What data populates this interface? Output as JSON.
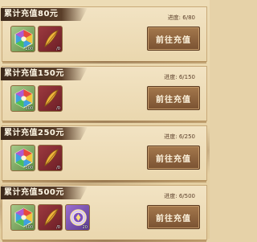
{
  "cards": [
    {
      "title": "累计充值80元",
      "progress": "进度: 6/80",
      "button": "前往充值",
      "rewards": [
        {
          "icon": "hexagon-gem-icon",
          "count": "200"
        },
        {
          "icon": "golden-feather-icon",
          "count": "/0"
        }
      ]
    },
    {
      "title": "累计充值150元",
      "progress": "进度: 6/150",
      "button": "前往充值",
      "rewards": [
        {
          "icon": "hexagon-gem-icon",
          "count": "300"
        },
        {
          "icon": "golden-feather-icon",
          "count": "/0"
        }
      ]
    },
    {
      "title": "累计充值250元",
      "progress": "进度: 6/250",
      "button": "前往充值",
      "rewards": [
        {
          "icon": "hexagon-gem-icon",
          "count": "300"
        },
        {
          "icon": "golden-feather-icon",
          "count": "/0"
        }
      ]
    },
    {
      "title": "累计充值500元",
      "progress": "进度: 6/500",
      "button": "前往充值",
      "rewards": [
        {
          "icon": "hexagon-gem-icon",
          "count": "500"
        },
        {
          "icon": "golden-feather-icon",
          "count": "/0"
        },
        {
          "icon": "gold-token-icon",
          "count": "20"
        }
      ]
    }
  ],
  "colors": {
    "banner": "#4a3322",
    "button": "#8c603c",
    "gem_tile": "#6f9a52",
    "feather_tile": "#7f2830",
    "token_tile": "#7a52b0"
  }
}
